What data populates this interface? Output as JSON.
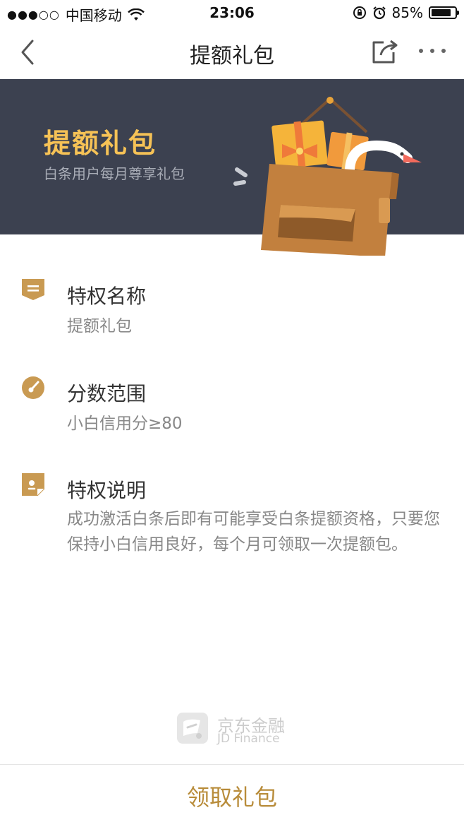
{
  "status_bar": {
    "signal": "●●●○○",
    "carrier": "中国移动",
    "time": "23:06",
    "battery": "85%",
    "battery_level": 0.85
  },
  "nav": {
    "title": "提额礼包",
    "back_icon": "chevron-left-icon",
    "share_icon": "share-icon",
    "more_icon": "more-dots-icon"
  },
  "banner": {
    "title": "提额礼包",
    "subtitle": "白条用户每月尊享礼包",
    "title_color": "#f6c256",
    "bg_color": "#3c4150"
  },
  "sections": [
    {
      "icon": "tag-icon",
      "title": "特权名称",
      "body": "提额礼包"
    },
    {
      "icon": "gauge-icon",
      "title": "分数范围",
      "body": "小白信用分≥80"
    },
    {
      "icon": "note-icon",
      "title": "特权说明",
      "body": "成功激活白条后即有可能享受白条提额资格，只要您保持小白信用良好，每个月可领取一次提额包。"
    }
  ],
  "brand": {
    "name_cn": "京东金融",
    "name_en": "JD Finance"
  },
  "bottom": {
    "claim_label": "领取礼包",
    "accent_color": "#b88c3a"
  }
}
